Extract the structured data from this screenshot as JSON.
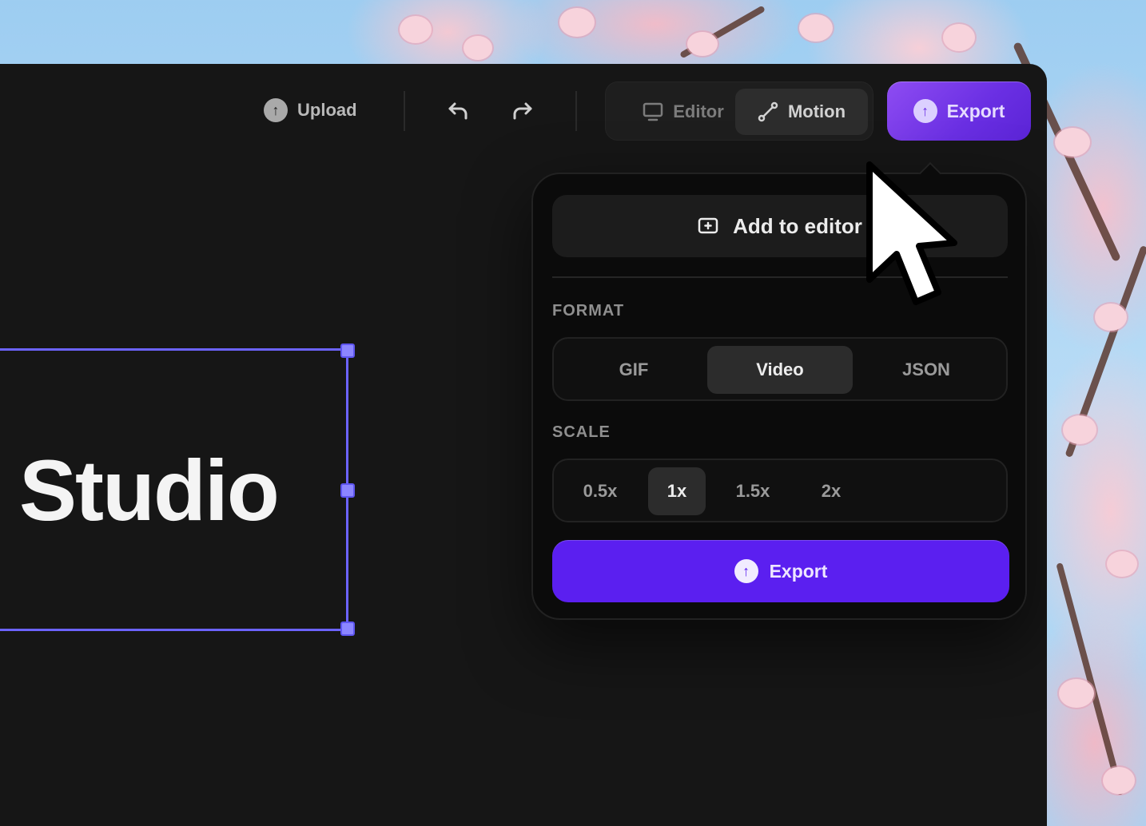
{
  "toolbar": {
    "upload_label": "Upload",
    "upload_icon": "upload-circle-icon",
    "undo_icon": "undo-icon",
    "redo_icon": "redo-icon",
    "mode_editor_label": "Editor",
    "mode_motion_label": "Motion",
    "active_mode": "Motion",
    "export_label": "Export"
  },
  "canvas": {
    "text": "it Studio"
  },
  "popover": {
    "add_to_editor_label": "Add to editor",
    "format_label": "FORMAT",
    "formats": [
      "GIF",
      "Video",
      "JSON"
    ],
    "selected_format": "Video",
    "scale_label": "SCALE",
    "scales": [
      "0.5x",
      "1x",
      "1.5x",
      "2x"
    ],
    "selected_scale": "1x",
    "export_label": "Export"
  },
  "colors": {
    "accent_purple": "#5b1ff0",
    "export_gradient_start": "#8e4cf2",
    "selection_frame": "#6c63ff",
    "app_background": "#161616"
  }
}
